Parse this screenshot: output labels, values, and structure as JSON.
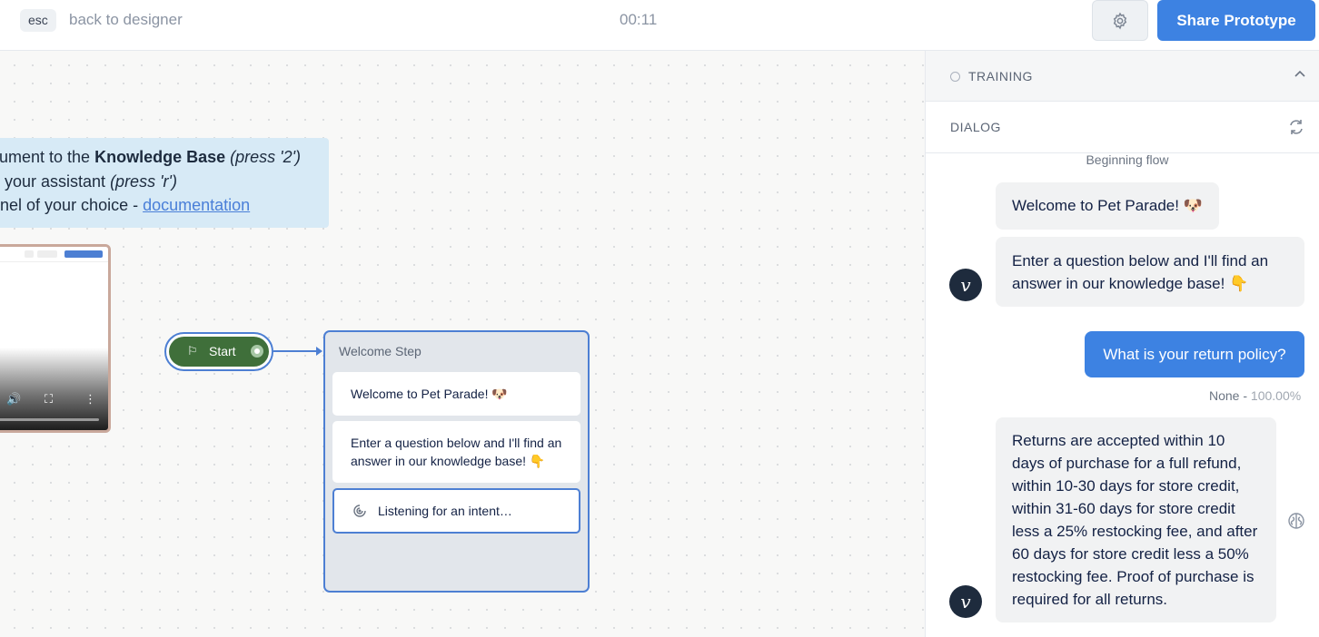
{
  "topbar": {
    "esc_key": "esc",
    "back_label": "back to designer",
    "timer": "00:11",
    "settings_icon": "gear-icon",
    "share_label": "Share Prototype"
  },
  "canvas": {
    "note": {
      "line1_prefix": "cument to the ",
      "line1_bold": "Knowledge Base",
      "line1_italic": " (press '2')",
      "line2_prefix": "n your assistant ",
      "line2_italic": "(press 'r')",
      "line3_prefix": "nnel of your choice - ",
      "line3_link": "documentation"
    },
    "start_node": {
      "label": "Start",
      "icon": "flag-icon"
    },
    "welcome_step": {
      "title": "Welcome Step",
      "card1": "Welcome to Pet Parade! 🐶",
      "card2": "Enter a question below and I'll find an answer in our knowledge base! 👇",
      "card3": "Listening for an intent…",
      "card3_icon": "listening-icon"
    }
  },
  "panel": {
    "training_label": "TRAINING",
    "dialog_label": "DIALOG",
    "flow_note": "Beginning flow",
    "messages": [
      {
        "from": "bot",
        "text": "Welcome to Pet Parade! 🐶"
      },
      {
        "from": "bot",
        "text": "Enter a question below and I'll find an answer in our knowledge base! 👇"
      },
      {
        "from": "user",
        "text": "What is your return policy?"
      },
      {
        "from": "bot",
        "text": "Returns are accepted within 10 days of purchase for a full refund, within 10-30 days for store credit, within 31-60 days for store credit less a 25% restocking fee, and after 60 days for store credit less a 50% restocking fee. Proof of purchase is required for all returns."
      }
    ],
    "match_label": "None - ",
    "match_pct": "100.00%",
    "avatar_letter": "v"
  },
  "colors": {
    "accent": "#3d82e2",
    "start_green": "#3f6f3a",
    "note_bg": "#d7eaf6",
    "avatar": "#1e2b3d"
  }
}
